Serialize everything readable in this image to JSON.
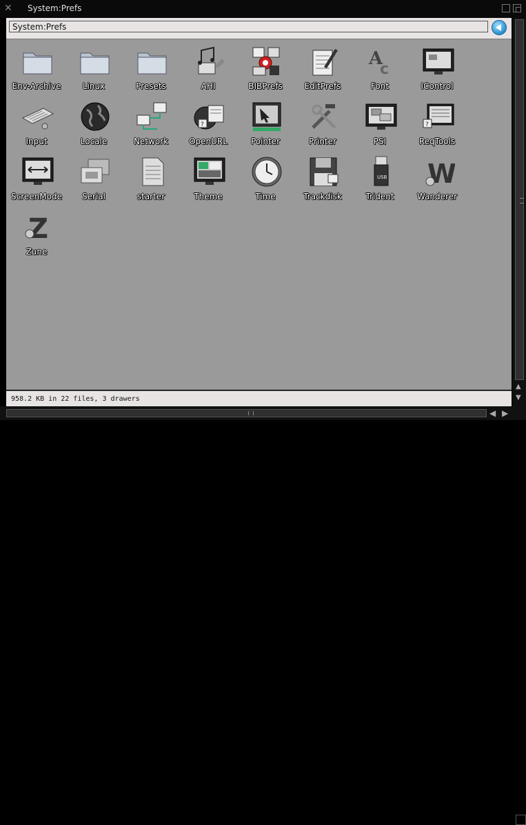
{
  "window": {
    "title": "System:Prefs",
    "path": "System:Prefs"
  },
  "status": "958.2 KB in 22 files, 3 drawers",
  "icons": [
    {
      "label": "Env-Archive",
      "icon": "folder-icon"
    },
    {
      "label": "Linux",
      "icon": "folder-icon"
    },
    {
      "label": "Presets",
      "icon": "folder-icon"
    },
    {
      "label": "AHI",
      "icon": "music-notes-icon"
    },
    {
      "label": "BIBPrefs",
      "icon": "boot-prefs-icon"
    },
    {
      "label": "EditPrefs",
      "icon": "notepad-pen-icon"
    },
    {
      "label": "Font",
      "icon": "font-letters-icon"
    },
    {
      "label": "IControl",
      "icon": "monitor-icon"
    },
    {
      "label": "Input",
      "icon": "keyboard-icon"
    },
    {
      "label": "Locale",
      "icon": "globe-icon"
    },
    {
      "label": "Network",
      "icon": "network-icon"
    },
    {
      "label": "OpenURL",
      "icon": "globe-document-icon"
    },
    {
      "label": "Pointer",
      "icon": "pointer-icon"
    },
    {
      "label": "Printer",
      "icon": "tools-icon"
    },
    {
      "label": "PSI",
      "icon": "monitor-windows-icon"
    },
    {
      "label": "ReqTools",
      "icon": "requester-icon"
    },
    {
      "label": "ScreenMode",
      "icon": "screenmode-icon"
    },
    {
      "label": "Serial",
      "icon": "serial-icon"
    },
    {
      "label": "starter",
      "icon": "document-icon"
    },
    {
      "label": "Theme",
      "icon": "theme-icon"
    },
    {
      "label": "Time",
      "icon": "clock-icon"
    },
    {
      "label": "Trackdisk",
      "icon": "floppy-icon"
    },
    {
      "label": "Trident",
      "icon": "usb-stick-icon"
    },
    {
      "label": "Wanderer",
      "icon": "wanderer-w-icon"
    },
    {
      "label": "Zune",
      "icon": "zune-z-icon"
    }
  ]
}
